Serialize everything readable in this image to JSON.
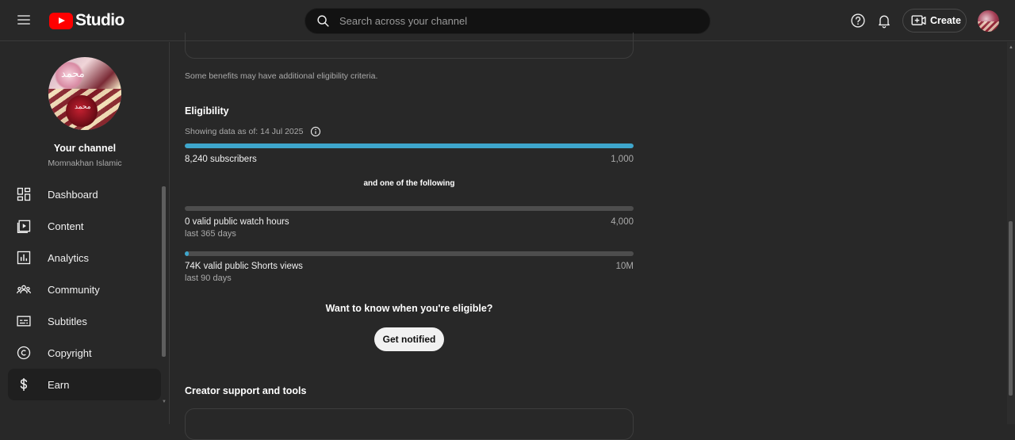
{
  "header": {
    "logo_text": "Studio",
    "search_placeholder": "Search across your channel",
    "create_label": "Create"
  },
  "sidebar": {
    "channel_name": "Your channel",
    "channel_handle": "Momnakhan Islamic",
    "items": [
      {
        "label": "Dashboard",
        "icon": "dashboard-icon"
      },
      {
        "label": "Content",
        "icon": "content-icon"
      },
      {
        "label": "Analytics",
        "icon": "analytics-icon"
      },
      {
        "label": "Community",
        "icon": "community-icon"
      },
      {
        "label": "Subtitles",
        "icon": "subtitles-icon"
      },
      {
        "label": "Copyright",
        "icon": "copyright-icon"
      },
      {
        "label": "Earn",
        "icon": "dollar-icon",
        "active": true
      }
    ]
  },
  "main": {
    "benefit_note": "Some benefits may have additional eligibility criteria.",
    "eligibility_title": "Eligibility",
    "data_as_of": "Showing data as of: 14 Jul 2025",
    "subscribers": {
      "label": "8,240 subscribers",
      "target": "1,000",
      "progress": 1.0
    },
    "and_one": "and one of the following",
    "watch_hours": {
      "label": "0 valid public watch hours",
      "sub": "last 365 days",
      "target": "4,000",
      "progress": 0.0
    },
    "shorts_views": {
      "label": "74K valid public Shorts views",
      "sub": "last 90 days",
      "target": "10M",
      "progress": 0.0074
    },
    "want_know": "Want to know when you're eligible?",
    "notify_label": "Get notified",
    "support_title": "Creator support and tools"
  },
  "colors": {
    "accent": "#3ea6cc",
    "background": "#282828",
    "brand_red": "#ff0000"
  }
}
